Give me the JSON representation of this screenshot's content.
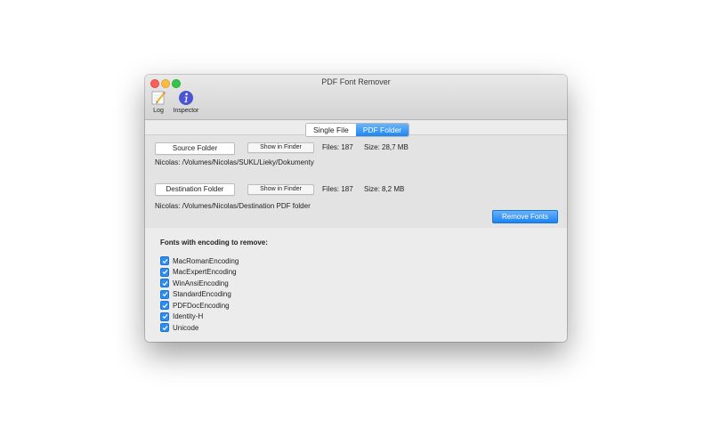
{
  "window": {
    "title": "PDF Font Remover"
  },
  "toolbar": {
    "log_label": "Log",
    "inspector_label": "Inspector"
  },
  "tabs": [
    {
      "label": "Single File",
      "active": false
    },
    {
      "label": "PDF Folder",
      "active": true
    }
  ],
  "source": {
    "button_label": "Source Folder",
    "show_label": "Show in Finder",
    "files": "Files: 187",
    "size": "Size: 28,7 MB",
    "path": "Nicolas: /Volumes/Nicolas/SUKL/Lieky/Dokumenty"
  },
  "destination": {
    "button_label": "Destination Folder",
    "show_label": "Show in Finder",
    "files": "Files: 187",
    "size": "Size: 8,2 MB",
    "path": "Nicolas: /Volumes/Nicolas/Destination PDF folder"
  },
  "remove_button_label": "Remove Fonts",
  "encodings": {
    "heading": "Fonts with encoding to remove:",
    "items": [
      {
        "label": "MacRomanEncoding",
        "checked": true
      },
      {
        "label": "MacExpertEncoding",
        "checked": true
      },
      {
        "label": "WinAnsiEncoding",
        "checked": true
      },
      {
        "label": "StandardEncoding",
        "checked": true
      },
      {
        "label": "PDFDocEncoding",
        "checked": true
      },
      {
        "label": "Identity-H",
        "checked": true
      },
      {
        "label": "Unicode",
        "checked": true
      }
    ]
  },
  "colors": {
    "accent": "#1c86f2",
    "checkbox": "#2d8cf0"
  }
}
